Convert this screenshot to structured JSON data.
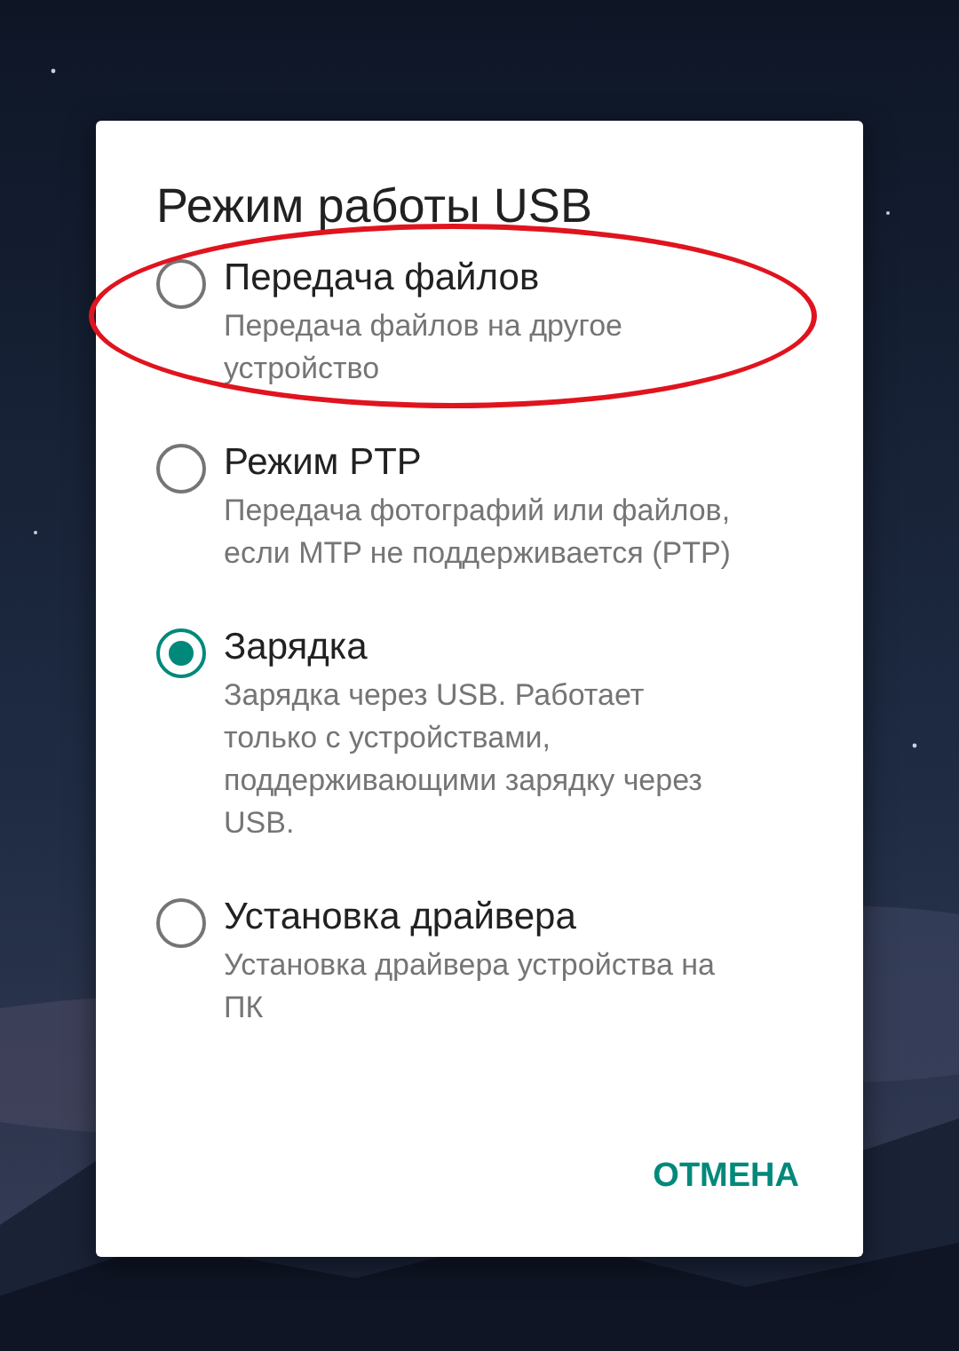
{
  "dialog": {
    "title": "Режим работы USB",
    "options": [
      {
        "label": "Передача файлов",
        "description": "Передача файлов на другое устройство",
        "selected": false,
        "circled": true
      },
      {
        "label": "Режим PTP",
        "description": "Передача фотографий или файлов, если MTP не поддерживается (PTP)",
        "selected": false,
        "circled": false
      },
      {
        "label": "Зарядка",
        "description": "Зарядка через USB. Работает только с устройствами, поддерживающими зарядку через USB.",
        "selected": true,
        "circled": false
      },
      {
        "label": "Установка драйвера",
        "description": "Установка драйвера устройства на ПК",
        "selected": false,
        "circled": false
      }
    ],
    "buttons": [
      "ОТМЕНА"
    ]
  }
}
